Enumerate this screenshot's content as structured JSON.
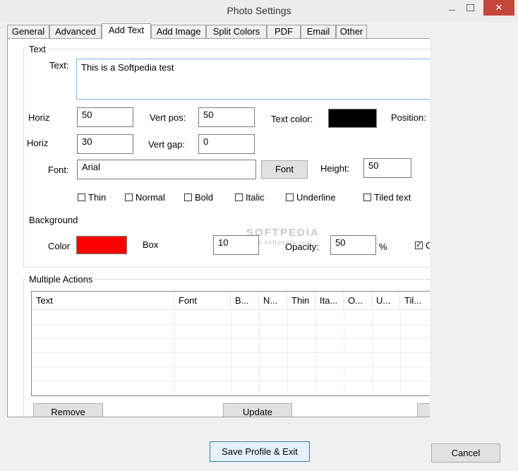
{
  "window": {
    "title": "Photo Settings",
    "close_glyph": "✕"
  },
  "tabs": [
    "General",
    "Advanced",
    "Add Text",
    "Add Image",
    "Split Colors",
    "PDF",
    "Email",
    "Other"
  ],
  "text_group": {
    "title": "Text",
    "text_label": "Text:",
    "text_value": "This is a Softpedia test",
    "horiz_label_1": "Horiz",
    "horiz_value_1": "50",
    "vert_pos_label": "Vert pos:",
    "vert_pos_value": "50",
    "text_color_label": "Text color:",
    "text_color": "#000000",
    "position_label": "Position:",
    "horiz_label_2": "Horiz",
    "horiz_value_2": "30",
    "vert_gap_label": "Vert gap:",
    "vert_gap_value": "0",
    "font_label": "Font:",
    "font_value": "Arial",
    "font_button": "Font",
    "height_label": "Height:",
    "height_value": "50",
    "checkboxes": [
      {
        "label": "Thin",
        "checked": false
      },
      {
        "label": "Normal",
        "checked": false
      },
      {
        "label": "Bold",
        "checked": false
      },
      {
        "label": "Italic",
        "checked": false
      },
      {
        "label": "Underline",
        "checked": false
      },
      {
        "label": "Tiled text",
        "checked": false
      }
    ]
  },
  "background": {
    "title": "Background",
    "color_label": "Color",
    "color": "#ff0000",
    "box_label": "Box",
    "box_value": "10",
    "opacity_label": "Opacity:",
    "opacity_value": "50",
    "percent": "%",
    "cut_checkbox_checked": true,
    "cut_label": "C"
  },
  "multiple_actions": {
    "title": "Multiple Actions",
    "columns": [
      "Text",
      "Font",
      "B...",
      "N...",
      "Thin",
      "Ita...",
      "O...",
      "U...",
      "Til..."
    ],
    "remove_button": "Remove",
    "update_button": "Update"
  },
  "footer": {
    "save_button": "Save Profile & Exit",
    "cancel_button": "Cancel"
  },
  "watermark": {
    "brand": "SOFTPEDIA",
    "url": "www.softpedia.com"
  }
}
